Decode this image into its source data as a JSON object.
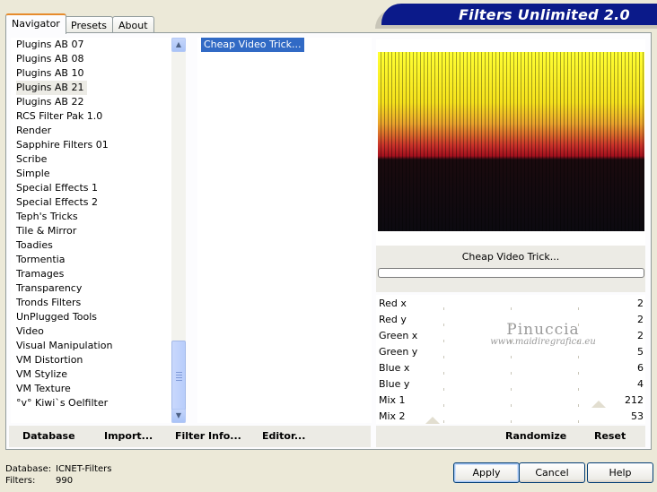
{
  "window": {
    "banner_title": "Filters Unlimited 2.0"
  },
  "tabs": [
    {
      "label": "Navigator",
      "active": true
    },
    {
      "label": "Presets",
      "active": false
    },
    {
      "label": "About",
      "active": false
    }
  ],
  "categories": {
    "items": [
      "Plugins AB 07",
      "Plugins AB 08",
      "Plugins AB 10",
      "Plugins AB 21",
      "Plugins AB 22",
      "RCS Filter Pak 1.0",
      "Render",
      "Sapphire Filters 01",
      "Scribe",
      "Simple",
      "Special Effects 1",
      "Special Effects 2",
      "Teph's Tricks",
      "Tile & Mirror",
      "Toadies",
      "Tormentia",
      "Tramages",
      "Transparency",
      "Tronds Filters",
      "UnPlugged Tools",
      "Video",
      "Visual Manipulation",
      "VM Distortion",
      "VM Stylize",
      "VM Texture",
      "°v° Kiwi`s Oelfilter"
    ],
    "selected": "Plugins AB 21"
  },
  "filters": {
    "items": [
      "Cheap Video Trick..."
    ],
    "selected": "Cheap Video Trick..."
  },
  "preview": {
    "filter_name": "Cheap Video Trick..."
  },
  "params": [
    {
      "label": "Red x",
      "value": "2"
    },
    {
      "label": "Red y",
      "value": "2"
    },
    {
      "label": "Green x",
      "value": "2"
    },
    {
      "label": "Green y",
      "value": "5"
    },
    {
      "label": "Blue x",
      "value": "6"
    },
    {
      "label": "Blue y",
      "value": "4"
    },
    {
      "label": "Mix 1",
      "value": "212"
    },
    {
      "label": "Mix 2",
      "value": "53"
    }
  ],
  "watermark": {
    "line1": "Pinuccia",
    "line2": "www.maidiregrafica.eu"
  },
  "toolbar": {
    "database": "Database",
    "import": "Import...",
    "filter_info": "Filter Info...",
    "editor": "Editor...",
    "randomize": "Randomize",
    "reset": "Reset"
  },
  "footer": {
    "database_label": "Database:",
    "database_value": "ICNET-Filters",
    "filters_label": "Filters:",
    "filters_value": "990"
  },
  "buttons": {
    "apply": "Apply",
    "cancel": "Cancel",
    "help": "Help"
  },
  "icons": {
    "scroll_up": "chevron-up-icon",
    "scroll_down": "chevron-down-icon"
  },
  "colors": {
    "banner": "#0b1a8a",
    "selection": "#316ac5",
    "tab_highlight": "#e68b2c"
  }
}
